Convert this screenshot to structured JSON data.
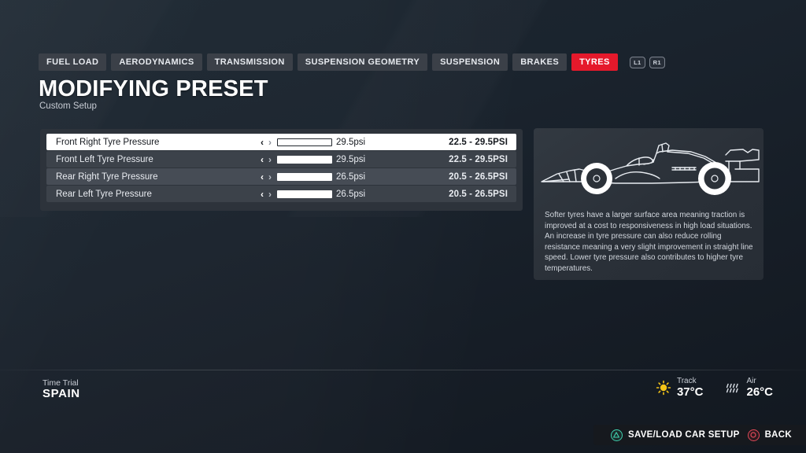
{
  "tabs": [
    {
      "label": "FUEL LOAD",
      "active": false
    },
    {
      "label": "AERODYNAMICS",
      "active": false
    },
    {
      "label": "TRANSMISSION",
      "active": false
    },
    {
      "label": "SUSPENSION GEOMETRY",
      "active": false
    },
    {
      "label": "SUSPENSION",
      "active": false
    },
    {
      "label": "BRAKES",
      "active": false
    },
    {
      "label": "TYRES",
      "active": true
    }
  ],
  "bumpers": {
    "left": "L1",
    "right": "R1"
  },
  "header": {
    "title": "MODIFYING PRESET",
    "subtitle": "Custom Setup"
  },
  "settings": {
    "rows": [
      {
        "label": "Front Right Tyre Pressure",
        "value": "29.5psi",
        "range": "22.5 - 29.5PSI",
        "fill_percent": 100,
        "selected": true
      },
      {
        "label": "Front Left Tyre Pressure",
        "value": "29.5psi",
        "range": "22.5 - 29.5PSI",
        "fill_percent": 100,
        "selected": false
      },
      {
        "label": "Rear Right Tyre Pressure",
        "value": "26.5psi",
        "range": "20.5 - 26.5PSI",
        "fill_percent": 100,
        "selected": false
      },
      {
        "label": "Rear Left Tyre Pressure",
        "value": "26.5psi",
        "range": "20.5 - 26.5PSI",
        "fill_percent": 100,
        "selected": false
      }
    ],
    "arrow_left": "‹",
    "arrow_right": "›"
  },
  "info": {
    "description": "Softer tyres have a larger surface area meaning traction is improved at a cost to responsiveness in high load situations. An increase in tyre pressure can also reduce rolling resistance meaning a very slight improvement in straight line speed. Lower tyre pressure also contributes to higher tyre temperatures."
  },
  "status": {
    "mode_label": "Time Trial",
    "mode_name": "SPAIN",
    "track_label": "Track",
    "track_temp": "37°C",
    "air_label": "Air",
    "air_temp": "26°C"
  },
  "actions": [
    {
      "label": "SAVE/LOAD CAR SETUP",
      "button": "triangle"
    },
    {
      "label": "BACK",
      "button": "circle"
    }
  ],
  "colors": {
    "accent_red": "#e5192b",
    "background": "#1a232d",
    "panel": "#2d333b",
    "row": "#3c424a",
    "selected_row": "#ffffff",
    "sun_yellow": "#f5c518",
    "triangle_green": "#3fd2b0",
    "circle_red": "#e2495a"
  }
}
